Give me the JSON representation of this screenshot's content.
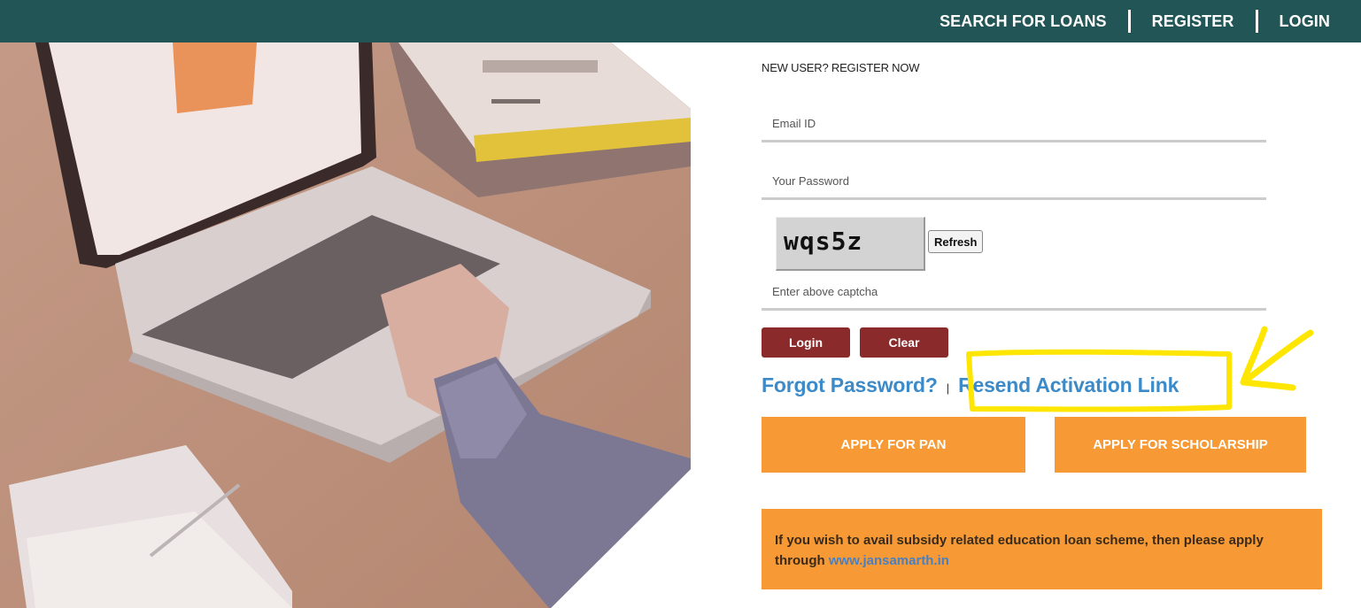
{
  "nav": {
    "items": [
      {
        "label": "SEARCH FOR LOANS"
      },
      {
        "label": "REGISTER"
      },
      {
        "label": "LOGIN"
      }
    ],
    "background_color": "#225555"
  },
  "hero": {
    "description": "Photo of a person typing on a laptop at a wooden desk with books and a notebook"
  },
  "login_form": {
    "register_prompt": "NEW USER? REGISTER NOW",
    "email": {
      "placeholder": "Email ID",
      "value": ""
    },
    "password": {
      "placeholder": "Your Password",
      "value": ""
    },
    "captcha": {
      "image_text": "wqs5z",
      "refresh_label": "Refresh",
      "input_placeholder": "Enter above captcha",
      "input_value": ""
    },
    "login_label": "Login",
    "clear_label": "Clear",
    "forgot_password_label": "Forgot Password?",
    "link_separator": "|",
    "resend_activation_label": "Resend Activation Link",
    "apply_pan_label": "APPLY FOR PAN",
    "apply_scholarship_label": "APPLY FOR SCHOLARSHIP"
  },
  "notice": {
    "text": "If you wish to avail subsidy related education loan scheme, then please apply through ",
    "link_text": "www.jansamarth.in"
  },
  "annotation": {
    "type": "yellow hand-drawn box and arrow highlighting Resend Activation Link",
    "color": "#ffe600"
  },
  "colors": {
    "accent_red": "#8b2a2a",
    "accent_orange": "#f79a35",
    "link_blue": "#3d8ac8"
  }
}
